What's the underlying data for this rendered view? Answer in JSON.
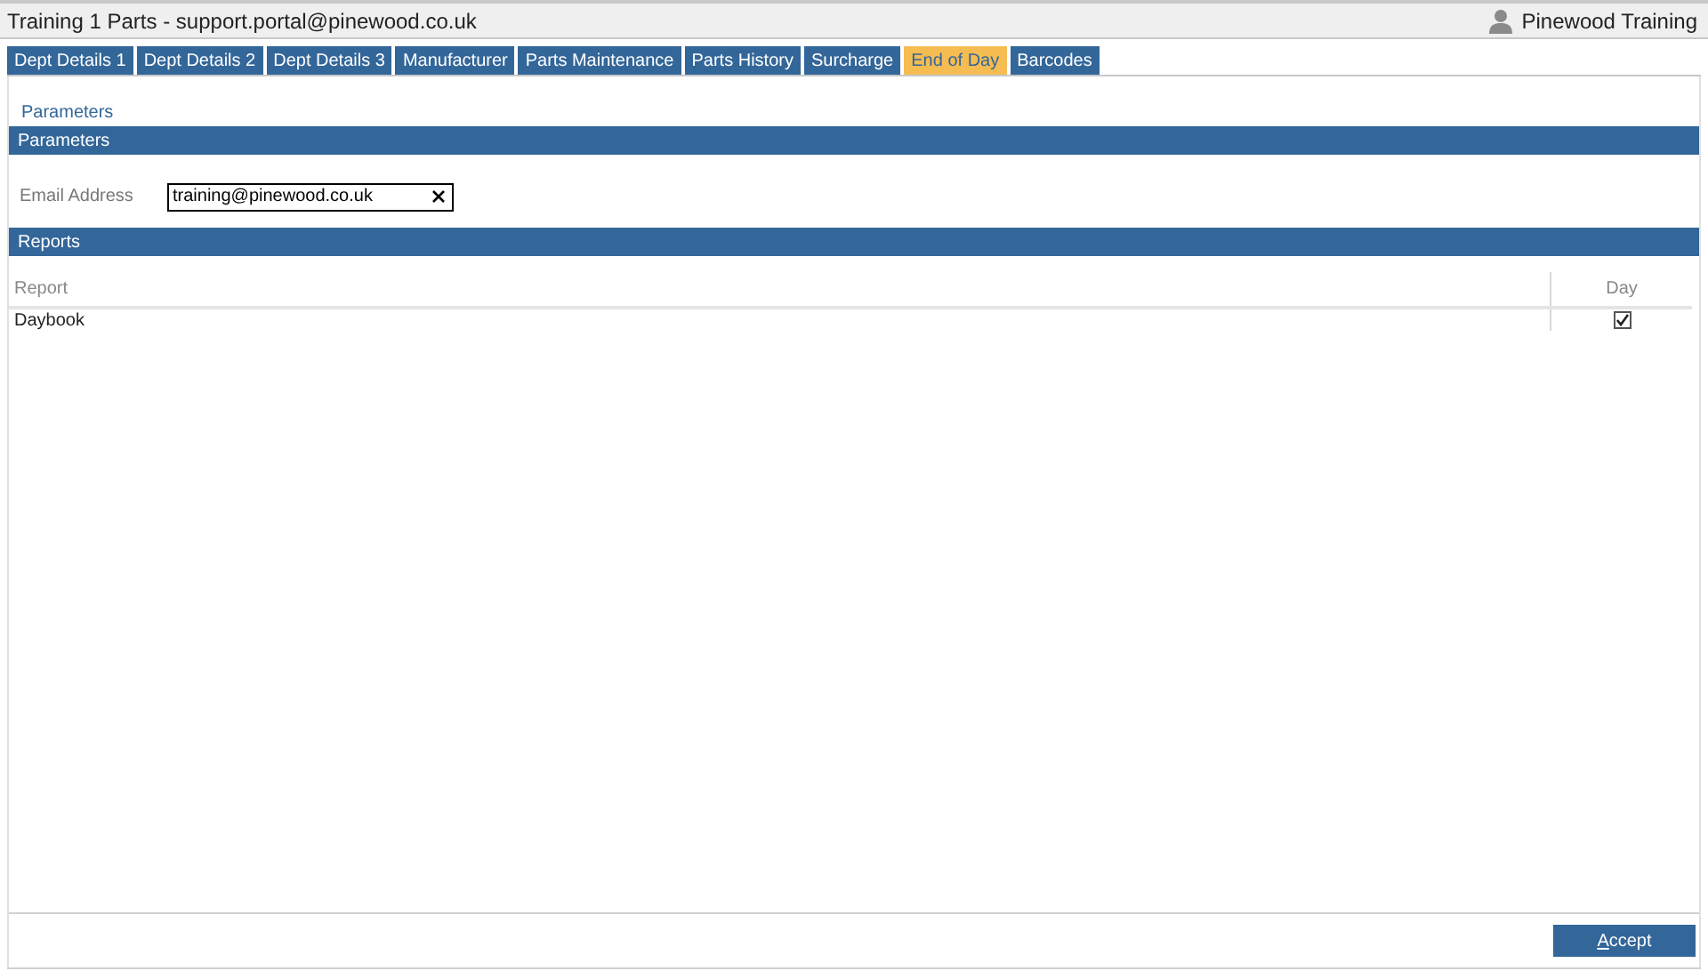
{
  "window": {
    "title": "Training 1 Parts - support.portal@pinewood.co.uk",
    "user": "Pinewood Training"
  },
  "tabs": [
    {
      "label": "Dept Details 1",
      "selected": false
    },
    {
      "label": "Dept Details 2",
      "selected": false
    },
    {
      "label": "Dept Details 3",
      "selected": false
    },
    {
      "label": "Manufacturer",
      "selected": false
    },
    {
      "label": "Parts Maintenance",
      "selected": false
    },
    {
      "label": "Parts History",
      "selected": false
    },
    {
      "label": "Surcharge",
      "selected": false
    },
    {
      "label": "End of Day",
      "selected": true
    },
    {
      "label": "Barcodes",
      "selected": false
    }
  ],
  "page_heading": "Parameters",
  "parameters": {
    "heading": "Parameters",
    "email": {
      "label": "Email Address",
      "value": "training@pinewood.co.uk"
    }
  },
  "reports": {
    "heading": "Reports",
    "columns": [
      "Report",
      "Day"
    ],
    "rows": [
      {
        "report": "Daybook",
        "day_checked": true
      }
    ]
  },
  "buttons": [
    {
      "label": "Accept"
    }
  ]
}
